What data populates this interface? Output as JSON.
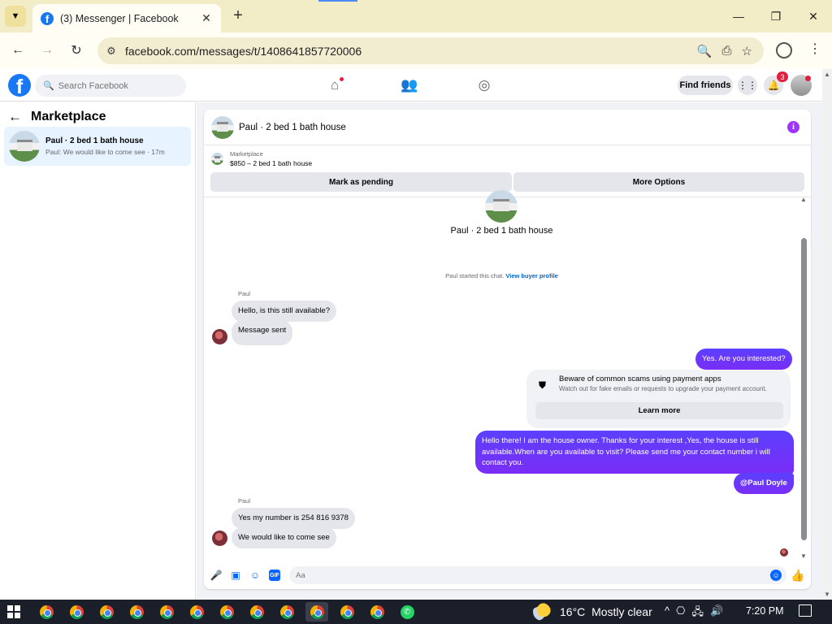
{
  "browser": {
    "tab_title": "(3) Messenger | Facebook",
    "url": "facebook.com/messages/t/1408641857720006"
  },
  "fb_header": {
    "search_placeholder": "Search Facebook",
    "find_friends_label": "Find friends",
    "notification_count": "3"
  },
  "sidebar": {
    "title": "Marketplace",
    "conversations": [
      {
        "name": "Paul · 2 bed 1 bath house",
        "preview": "Paul: We would like to come see · 17m"
      }
    ]
  },
  "chat": {
    "header_title": "Paul · 2 bed 1 bath house",
    "listing": {
      "category": "Marketplace",
      "price_title": "$850 – 2 bed 1 bath house",
      "mark_pending_label": "Mark as pending",
      "more_options_label": "More Options"
    },
    "center_title": "Paul · 2 bed 1 bath house",
    "system_message": "Paul started this chat.",
    "system_link": "View buyer profile",
    "messages": [
      {
        "sender": "Paul",
        "text": "Hello, is this still available?"
      },
      {
        "text": "Message sent"
      },
      {
        "text": "Yes. Are you interested?"
      },
      {
        "text": "Hello there! I am the house owner. Thanks for your interest ,Yes, the house is still available.When are you available to visit? Please send me your contact number i will contact you."
      },
      {
        "text": "@Paul Doyle"
      },
      {
        "sender": "Paul",
        "text": "Yes my number is 254 816 9378"
      },
      {
        "text": "We would like to come see"
      }
    ],
    "scam_notice": {
      "title": "Beware of common scams using payment apps",
      "subtitle": "Watch out for fake emails or requests to upgrade your payment account.",
      "button": "Learn more"
    },
    "composer_placeholder": "Aa"
  },
  "taskbar": {
    "temperature": "16°C",
    "weather": "Mostly clear",
    "time": "7:20 PM"
  },
  "colors": {
    "fb_blue": "#1877f2",
    "outgoing_bubble": "#6b3cff",
    "incoming_bubble": "#e4e6eb",
    "chrome_frame": "#f2ecc7"
  }
}
